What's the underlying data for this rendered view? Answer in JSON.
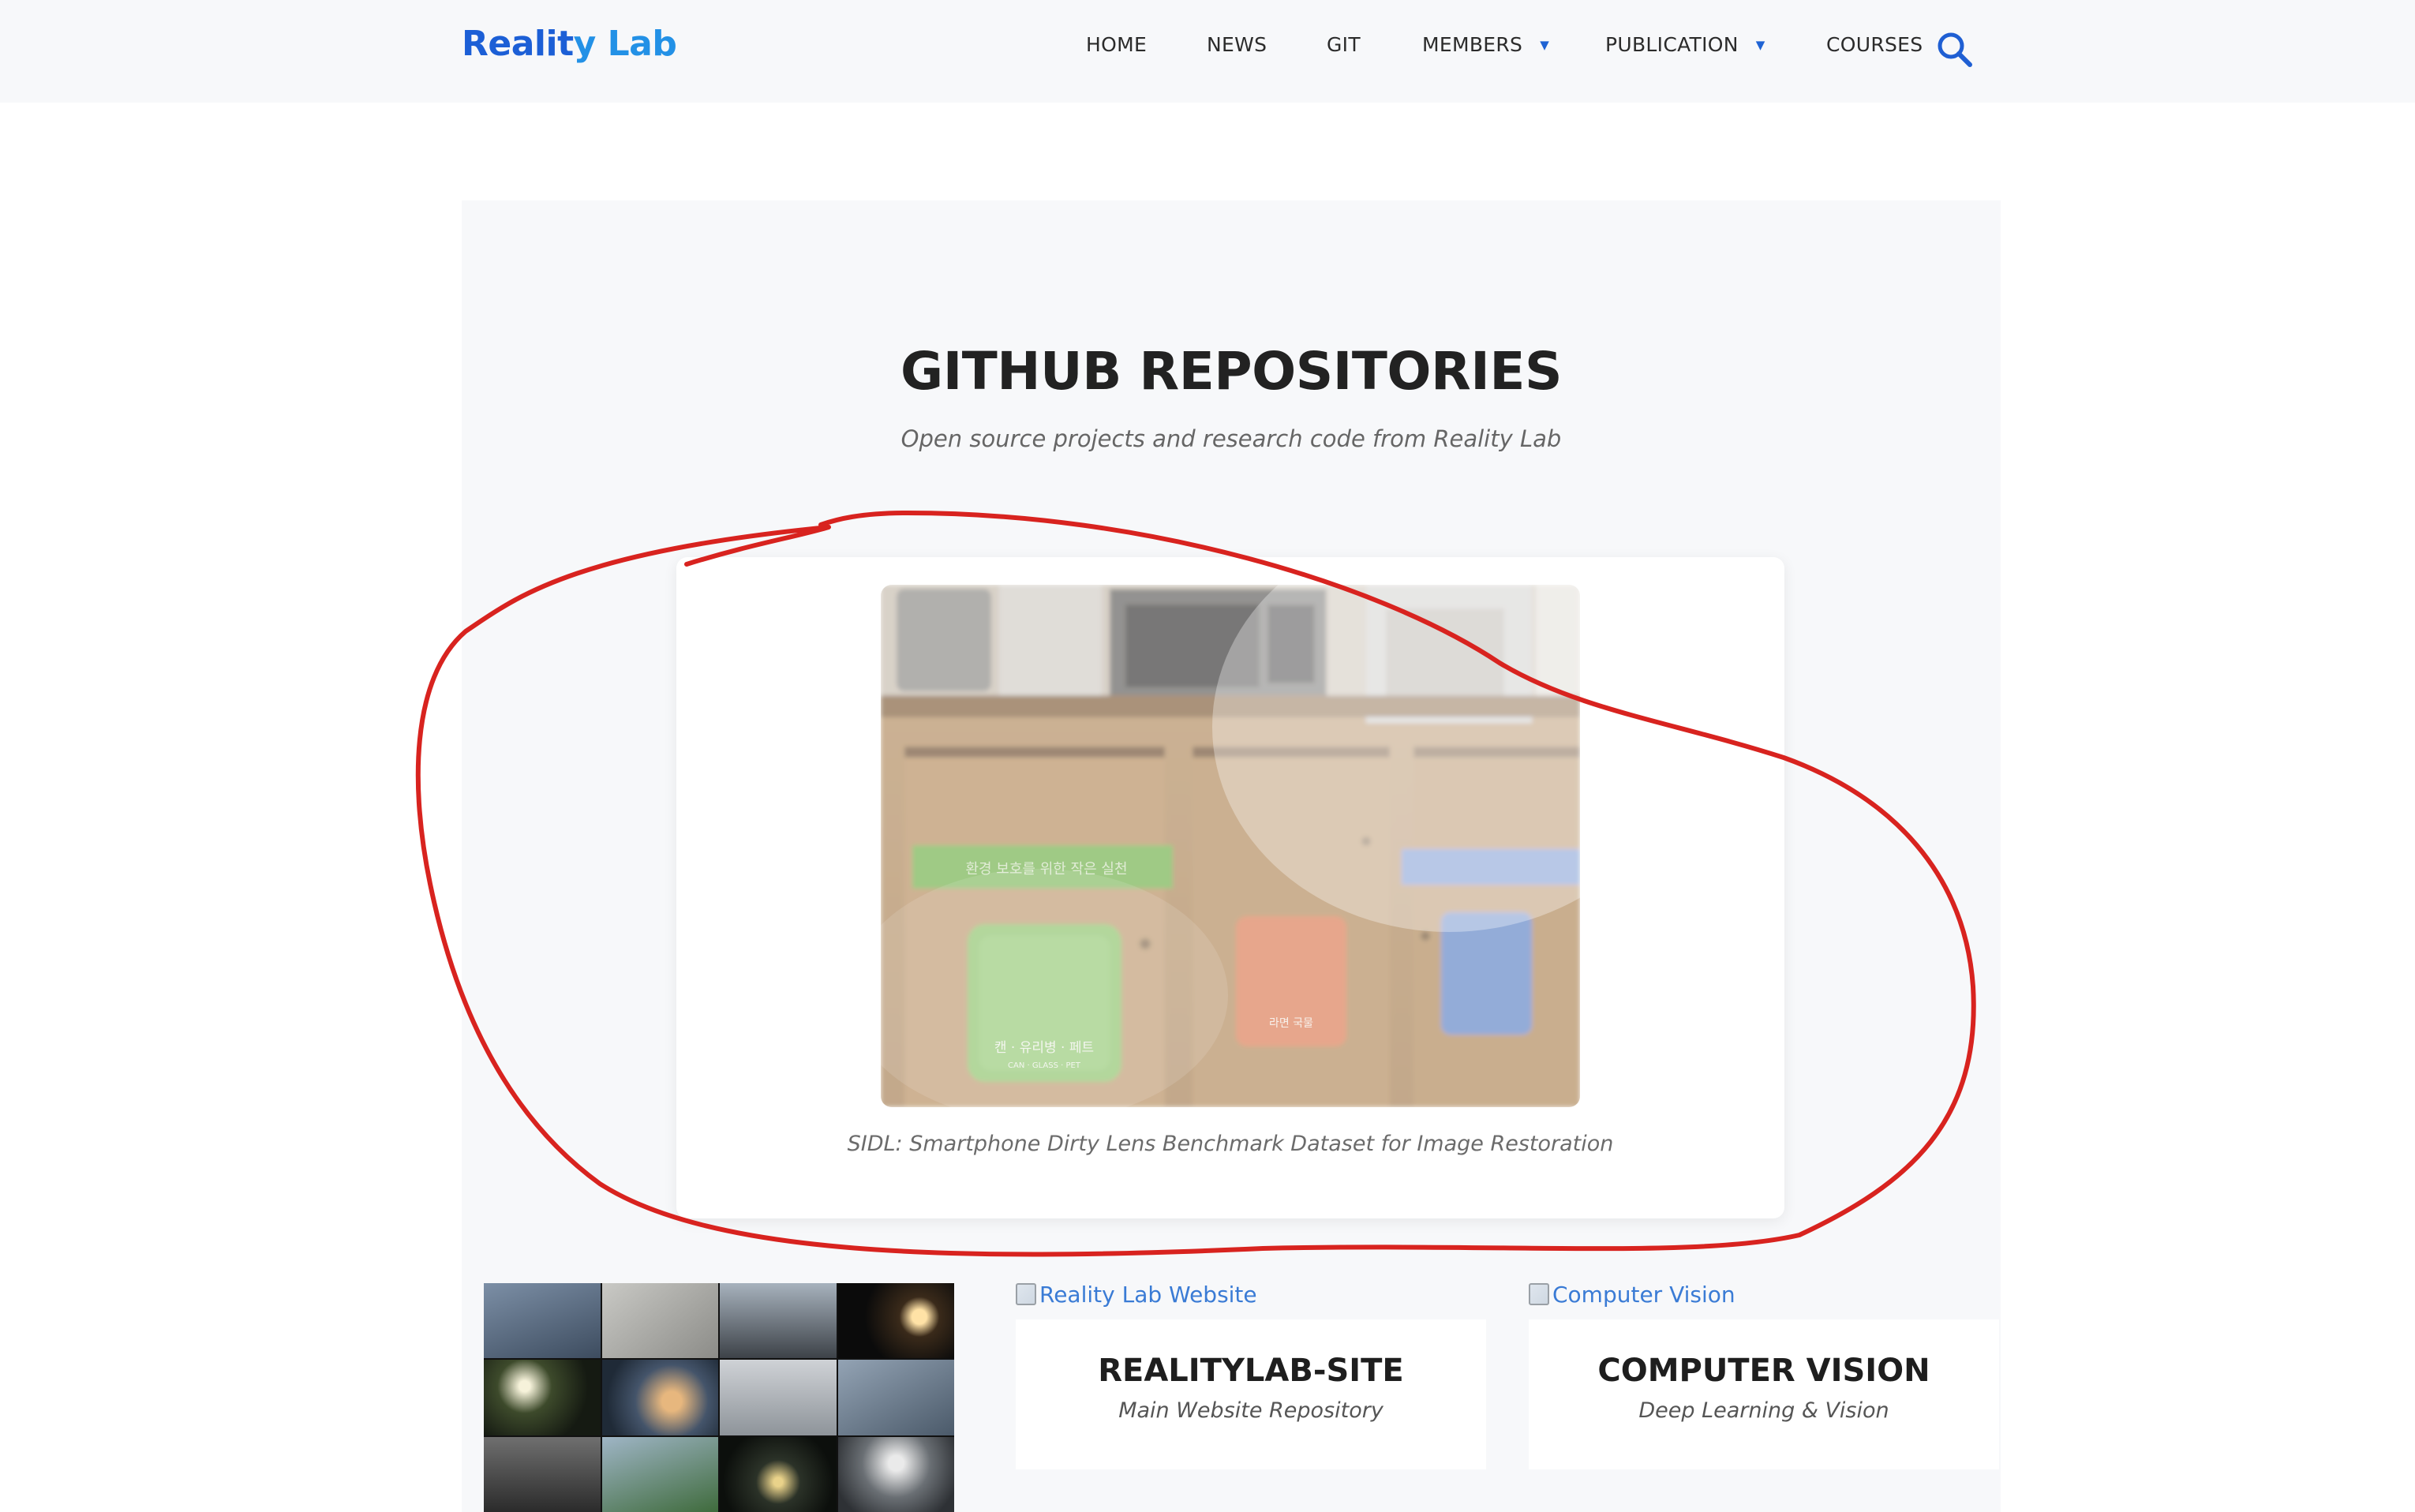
{
  "header": {
    "logo_part1": "Realit",
    "logo_part2": "y Lab",
    "nav": [
      {
        "label": "HOME"
      },
      {
        "label": "NEWS"
      },
      {
        "label": "GIT"
      },
      {
        "label": "MEMBERS"
      },
      {
        "label": "PUBLICATION"
      },
      {
        "label": "COURSES"
      }
    ],
    "search_icon": "search-icon"
  },
  "main": {
    "title": "GITHUB REPOSITORIES",
    "subtitle": "Open source projects and research code from Reality Lab",
    "featured": {
      "caption": "SIDL: Smartphone Dirty Lens Benchmark Dataset for Image Restoration",
      "sign_text": "환경 보호를 위한 작은 실천",
      "bin_label": "캔 · 유리병 · 페트",
      "bin_sublabel": "CAN · GLASS · PET",
      "bin2_label": "라면 국물"
    },
    "repos": [
      {
        "img_alt": "Reality Lab Website",
        "title": "REALITYLAB-SITE",
        "subtitle": "Main Website Repository"
      },
      {
        "img_alt": "Computer Vision",
        "title": "COMPUTER VISION",
        "subtitle": "Deep Learning & Vision"
      }
    ]
  },
  "colors": {
    "brand": "#1c5fd6",
    "annotation": "#d8231f"
  }
}
